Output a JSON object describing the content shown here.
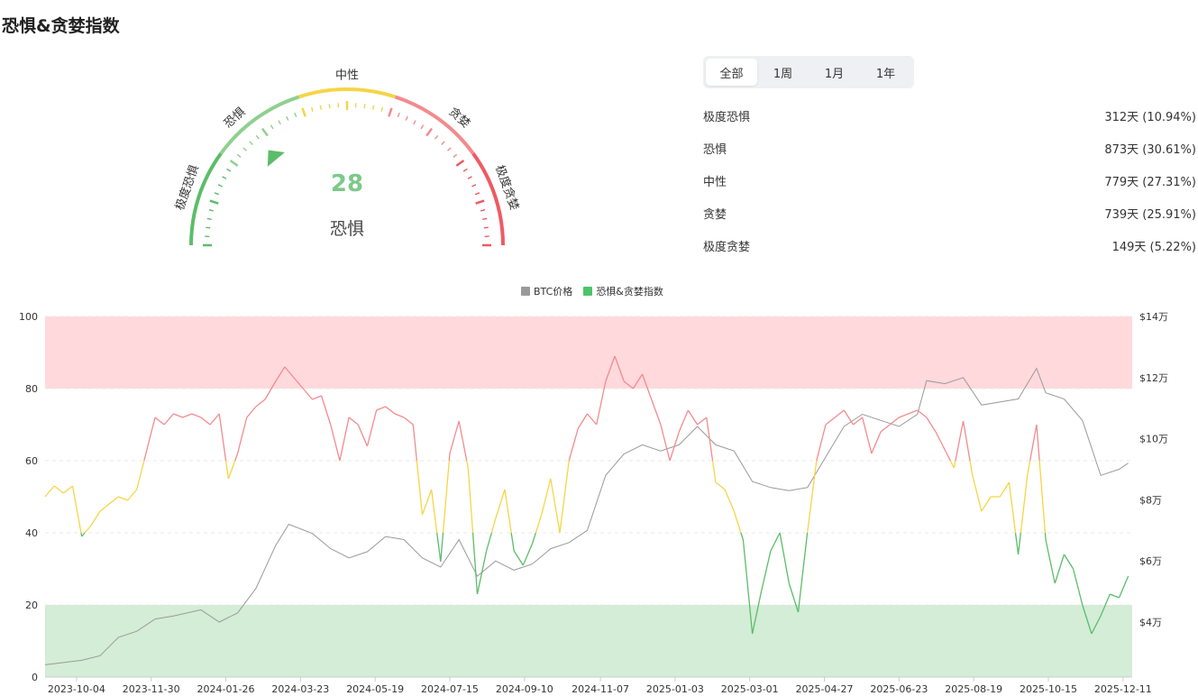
{
  "page": {
    "title": "恐惧&贪婪指数"
  },
  "gauge": {
    "value": 28,
    "label": "恐惧",
    "zones": [
      "极度恐惧",
      "恐惧",
      "中性",
      "贪婪",
      "极度贪婪"
    ],
    "colors": {
      "extreme_fear": "#5bbd6a",
      "fear": "#8fd08f",
      "neutral": "#f5d547",
      "greed": "#f28b8f",
      "extreme_greed": "#ee5a62"
    }
  },
  "tabs": [
    {
      "label": "全部",
      "active": true
    },
    {
      "label": "1周",
      "active": false
    },
    {
      "label": "1月",
      "active": false
    },
    {
      "label": "1年",
      "active": false
    }
  ],
  "stats": [
    {
      "label": "极度恐惧",
      "value": "312天 (10.94%)"
    },
    {
      "label": "恐惧",
      "value": "873天 (30.61%)"
    },
    {
      "label": "中性",
      "value": "779天 (27.31%)"
    },
    {
      "label": "贪婪",
      "value": "739天 (25.91%)"
    },
    {
      "label": "极度贪婪",
      "value": "149天 (5.22%)"
    }
  ],
  "chart_data": {
    "type": "line",
    "legend": [
      {
        "name": "BTC价格",
        "color": "#999999"
      },
      {
        "name": "恐惧&贪婪指数",
        "color": "#4cc46a"
      }
    ],
    "x_ticks": [
      "2023-10-04",
      "2023-11-30",
      "2024-01-26",
      "2024-03-23",
      "2024-05-19",
      "2024-07-15",
      "2024-09-10",
      "2024-11-07",
      "2025-01-03",
      "2025-03-01",
      "2025-04-27",
      "2025-06-23",
      "2025-08-19",
      "2025-10-15",
      "2025-12-11"
    ],
    "y_left": {
      "ticks": [
        0,
        20,
        40,
        60,
        80,
        100
      ],
      "range": [
        0,
        100
      ]
    },
    "y_right": {
      "ticks": [
        "$4万",
        "$6万",
        "$8万",
        "$10万",
        "$12万",
        "$14万"
      ],
      "values": [
        40000,
        60000,
        80000,
        100000,
        120000,
        140000
      ],
      "range": [
        22000,
        140000
      ]
    },
    "bands": [
      {
        "from": 80,
        "to": 100,
        "color": "#ffd9dc"
      },
      {
        "from": 0,
        "to": 20,
        "color": "#d3edd6"
      }
    ],
    "threshold_colors": {
      "low": "#5bbd6a",
      "mid": "#f5d547",
      "high": "#f28b8f"
    },
    "fg_index": [
      [
        "2023-09-10",
        50
      ],
      [
        "2023-09-17",
        53
      ],
      [
        "2023-09-24",
        51
      ],
      [
        "2023-10-01",
        53
      ],
      [
        "2023-10-08",
        39
      ],
      [
        "2023-10-15",
        42
      ],
      [
        "2023-10-22",
        46
      ],
      [
        "2023-10-29",
        48
      ],
      [
        "2023-11-05",
        50
      ],
      [
        "2023-11-12",
        49
      ],
      [
        "2023-11-19",
        52
      ],
      [
        "2023-11-26",
        62
      ],
      [
        "2023-12-03",
        72
      ],
      [
        "2023-12-10",
        70
      ],
      [
        "2023-12-17",
        73
      ],
      [
        "2023-12-24",
        72
      ],
      [
        "2023-12-31",
        73
      ],
      [
        "2024-01-07",
        72
      ],
      [
        "2024-01-14",
        70
      ],
      [
        "2024-01-21",
        73
      ],
      [
        "2024-01-28",
        55
      ],
      [
        "2024-02-04",
        62
      ],
      [
        "2024-02-11",
        72
      ],
      [
        "2024-02-18",
        75
      ],
      [
        "2024-02-25",
        77
      ],
      [
        "2024-03-04",
        82
      ],
      [
        "2024-03-11",
        86
      ],
      [
        "2024-03-18",
        83
      ],
      [
        "2024-03-25",
        80
      ],
      [
        "2024-04-01",
        77
      ],
      [
        "2024-04-08",
        78
      ],
      [
        "2024-04-15",
        70
      ],
      [
        "2024-04-22",
        60
      ],
      [
        "2024-04-29",
        72
      ],
      [
        "2024-05-06",
        70
      ],
      [
        "2024-05-13",
        64
      ],
      [
        "2024-05-20",
        74
      ],
      [
        "2024-05-27",
        75
      ],
      [
        "2024-06-03",
        73
      ],
      [
        "2024-06-10",
        72
      ],
      [
        "2024-06-17",
        70
      ],
      [
        "2024-06-24",
        45
      ],
      [
        "2024-07-01",
        52
      ],
      [
        "2024-07-08",
        32
      ],
      [
        "2024-07-15",
        62
      ],
      [
        "2024-07-22",
        71
      ],
      [
        "2024-07-29",
        58
      ],
      [
        "2024-08-05",
        23
      ],
      [
        "2024-08-12",
        35
      ],
      [
        "2024-08-19",
        44
      ],
      [
        "2024-08-26",
        52
      ],
      [
        "2024-09-02",
        35
      ],
      [
        "2024-09-09",
        31
      ],
      [
        "2024-09-16",
        37
      ],
      [
        "2024-09-23",
        45
      ],
      [
        "2024-09-30",
        55
      ],
      [
        "2024-10-07",
        40
      ],
      [
        "2024-10-14",
        60
      ],
      [
        "2024-10-21",
        69
      ],
      [
        "2024-10-28",
        73
      ],
      [
        "2024-11-04",
        70
      ],
      [
        "2024-11-11",
        82
      ],
      [
        "2024-11-18",
        89
      ],
      [
        "2024-11-25",
        82
      ],
      [
        "2024-12-02",
        80
      ],
      [
        "2024-12-09",
        84
      ],
      [
        "2024-12-16",
        77
      ],
      [
        "2024-12-23",
        70
      ],
      [
        "2024-12-30",
        60
      ],
      [
        "2025-01-06",
        68
      ],
      [
        "2025-01-13",
        74
      ],
      [
        "2025-01-20",
        70
      ],
      [
        "2025-01-27",
        72
      ],
      [
        "2025-02-03",
        54
      ],
      [
        "2025-02-10",
        52
      ],
      [
        "2025-02-17",
        46
      ],
      [
        "2025-02-24",
        38
      ],
      [
        "2025-03-03",
        12
      ],
      [
        "2025-03-10",
        24
      ],
      [
        "2025-03-17",
        35
      ],
      [
        "2025-03-24",
        40
      ],
      [
        "2025-03-31",
        26
      ],
      [
        "2025-04-07",
        18
      ],
      [
        "2025-04-14",
        40
      ],
      [
        "2025-04-21",
        60
      ],
      [
        "2025-04-28",
        70
      ],
      [
        "2025-05-05",
        72
      ],
      [
        "2025-05-12",
        74
      ],
      [
        "2025-05-19",
        70
      ],
      [
        "2025-05-26",
        72
      ],
      [
        "2025-06-02",
        62
      ],
      [
        "2025-06-09",
        68
      ],
      [
        "2025-06-16",
        70
      ],
      [
        "2025-06-23",
        72
      ],
      [
        "2025-07-07",
        74
      ],
      [
        "2025-07-14",
        72
      ],
      [
        "2025-07-21",
        68
      ],
      [
        "2025-07-28",
        63
      ],
      [
        "2025-08-04",
        58
      ],
      [
        "2025-08-11",
        71
      ],
      [
        "2025-08-18",
        56
      ],
      [
        "2025-08-25",
        46
      ],
      [
        "2025-09-01",
        50
      ],
      [
        "2025-09-08",
        50
      ],
      [
        "2025-09-15",
        54
      ],
      [
        "2025-09-22",
        34
      ],
      [
        "2025-09-29",
        56
      ],
      [
        "2025-10-06",
        70
      ],
      [
        "2025-10-13",
        38
      ],
      [
        "2025-10-20",
        26
      ],
      [
        "2025-10-27",
        34
      ],
      [
        "2025-11-03",
        30
      ],
      [
        "2025-11-10",
        20
      ],
      [
        "2025-11-17",
        12
      ],
      [
        "2025-11-24",
        17
      ],
      [
        "2025-12-01",
        23
      ],
      [
        "2025-12-08",
        22
      ],
      [
        "2025-12-15",
        28
      ]
    ],
    "btc_price": [
      [
        "2023-09-10",
        26000
      ],
      [
        "2023-10-08",
        27500
      ],
      [
        "2023-10-22",
        29000
      ],
      [
        "2023-11-05",
        35000
      ],
      [
        "2023-11-19",
        37000
      ],
      [
        "2023-12-03",
        41000
      ],
      [
        "2023-12-17",
        42000
      ],
      [
        "2024-01-07",
        44000
      ],
      [
        "2024-01-21",
        40000
      ],
      [
        "2024-02-04",
        43000
      ],
      [
        "2024-02-18",
        51000
      ],
      [
        "2024-03-04",
        65000
      ],
      [
        "2024-03-14",
        72000
      ],
      [
        "2024-04-01",
        69000
      ],
      [
        "2024-04-15",
        64000
      ],
      [
        "2024-04-29",
        61000
      ],
      [
        "2024-05-13",
        63000
      ],
      [
        "2024-05-27",
        68000
      ],
      [
        "2024-06-10",
        67000
      ],
      [
        "2024-06-24",
        61000
      ],
      [
        "2024-07-08",
        58000
      ],
      [
        "2024-07-22",
        67000
      ],
      [
        "2024-08-05",
        55000
      ],
      [
        "2024-08-19",
        60000
      ],
      [
        "2024-09-02",
        57000
      ],
      [
        "2024-09-16",
        59000
      ],
      [
        "2024-09-30",
        64000
      ],
      [
        "2024-10-14",
        66000
      ],
      [
        "2024-10-28",
        70000
      ],
      [
        "2024-11-11",
        88000
      ],
      [
        "2024-11-25",
        95000
      ],
      [
        "2024-12-09",
        98000
      ],
      [
        "2024-12-23",
        96000
      ],
      [
        "2025-01-06",
        98000
      ],
      [
        "2025-01-20",
        104000
      ],
      [
        "2025-02-03",
        98000
      ],
      [
        "2025-02-17",
        96000
      ],
      [
        "2025-03-03",
        86000
      ],
      [
        "2025-03-17",
        84000
      ],
      [
        "2025-03-31",
        83000
      ],
      [
        "2025-04-14",
        84000
      ],
      [
        "2025-04-28",
        94000
      ],
      [
        "2025-05-12",
        104000
      ],
      [
        "2025-05-26",
        108000
      ],
      [
        "2025-06-09",
        106000
      ],
      [
        "2025-06-23",
        104000
      ],
      [
        "2025-07-07",
        108000
      ],
      [
        "2025-07-14",
        119000
      ],
      [
        "2025-07-28",
        118000
      ],
      [
        "2025-08-11",
        120000
      ],
      [
        "2025-08-25",
        111000
      ],
      [
        "2025-09-08",
        112000
      ],
      [
        "2025-09-22",
        113000
      ],
      [
        "2025-10-06",
        123000
      ],
      [
        "2025-10-13",
        115000
      ],
      [
        "2025-10-27",
        113000
      ],
      [
        "2025-11-10",
        106000
      ],
      [
        "2025-11-24",
        88000
      ],
      [
        "2025-12-08",
        90000
      ],
      [
        "2025-12-15",
        92000
      ]
    ]
  }
}
